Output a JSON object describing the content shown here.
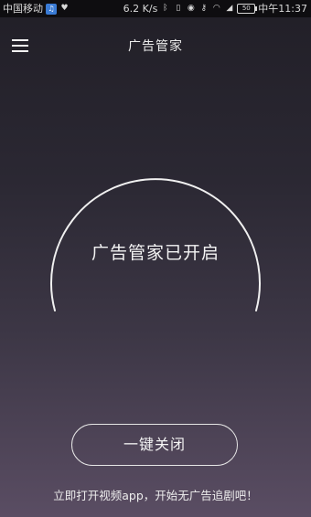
{
  "status_bar": {
    "carrier": "中国移动",
    "hd_icon": "hd-icon",
    "heart_icon": "heart-icon",
    "speed": "6.2 K/s",
    "bluetooth_icon": "bluetooth-icon",
    "vibrate_icon": "vibrate-icon",
    "eye_icon": "eye-icon",
    "key_icon": "key-icon",
    "wifi_icon": "wifi-icon",
    "signal_icon": "signal-icon",
    "battery_level": "50",
    "time": "中午11:37"
  },
  "header": {
    "menu_icon": "hamburger-menu-icon",
    "title": "广告管家"
  },
  "main": {
    "status_text": "广告管家已开启",
    "arc_color": "#f0f0f0"
  },
  "actions": {
    "close_all_label": "一键关闭"
  },
  "footer": {
    "tip": "立即打开视频app，开始无广告追剧吧！"
  },
  "colors": {
    "background_top": "#211f27",
    "background_bottom": "#5a4d63",
    "status_bar": "#0e0d10",
    "text": "#ffffff"
  }
}
